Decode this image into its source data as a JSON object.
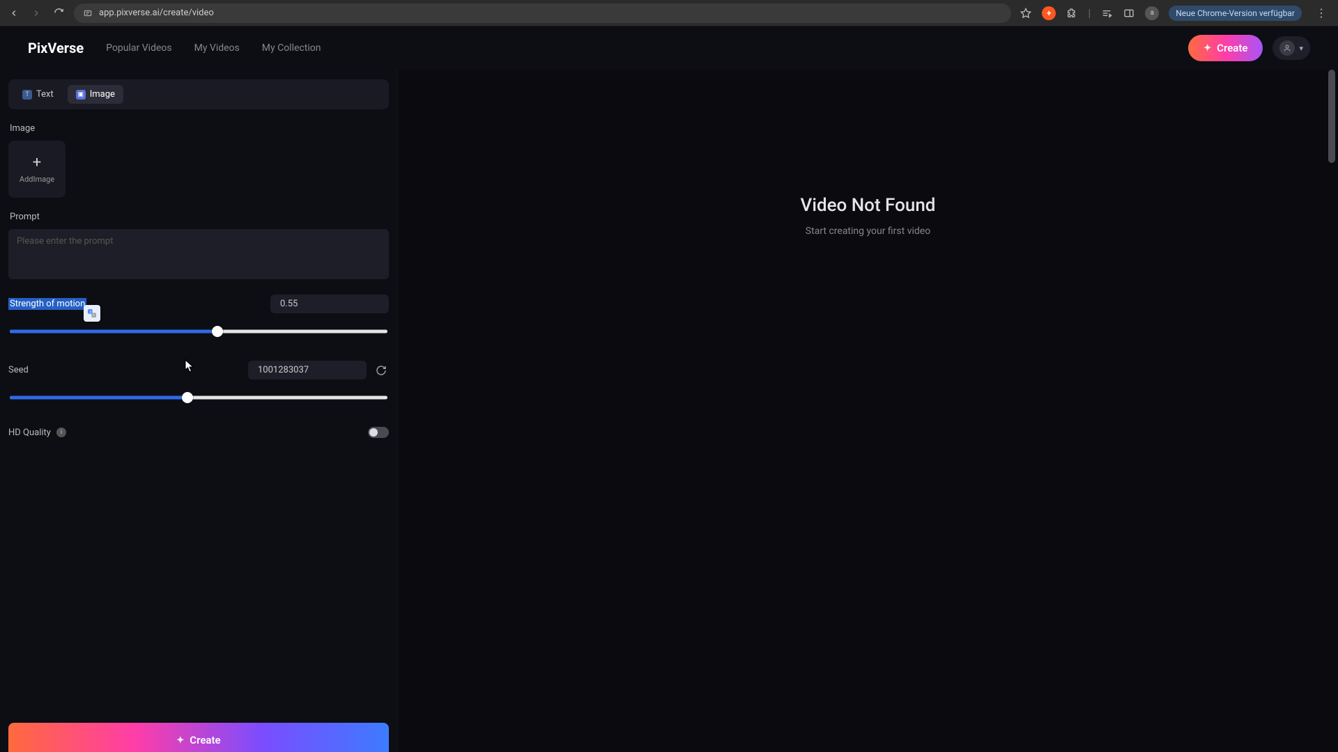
{
  "browser": {
    "url": "app.pixverse.ai/create/video",
    "update_label": "Neue Chrome-Version verfügbar",
    "avatar_initial": "a"
  },
  "header": {
    "logo": "PixVerse",
    "nav": [
      "Popular Videos",
      "My Videos",
      "My Collection"
    ],
    "create_label": "Create"
  },
  "sidebar": {
    "tabs": {
      "text": "Text",
      "image": "Image",
      "active": "image"
    },
    "image": {
      "label": "Image",
      "add_label": "AddImage"
    },
    "prompt": {
      "label": "Prompt",
      "placeholder": "Please enter the prompt"
    },
    "strength": {
      "label": "Strength of motion",
      "value": "0.55",
      "fill_pct": 55,
      "thumb_pct": 55
    },
    "seed": {
      "label": "Seed",
      "value": "1001283037",
      "fill_pct": 47,
      "thumb_pct": 47
    },
    "hd": {
      "label": "HD Quality",
      "on": false
    },
    "bottom_create": "Create"
  },
  "content": {
    "empty_title": "Video Not Found",
    "empty_sub": "Start creating your first video"
  }
}
